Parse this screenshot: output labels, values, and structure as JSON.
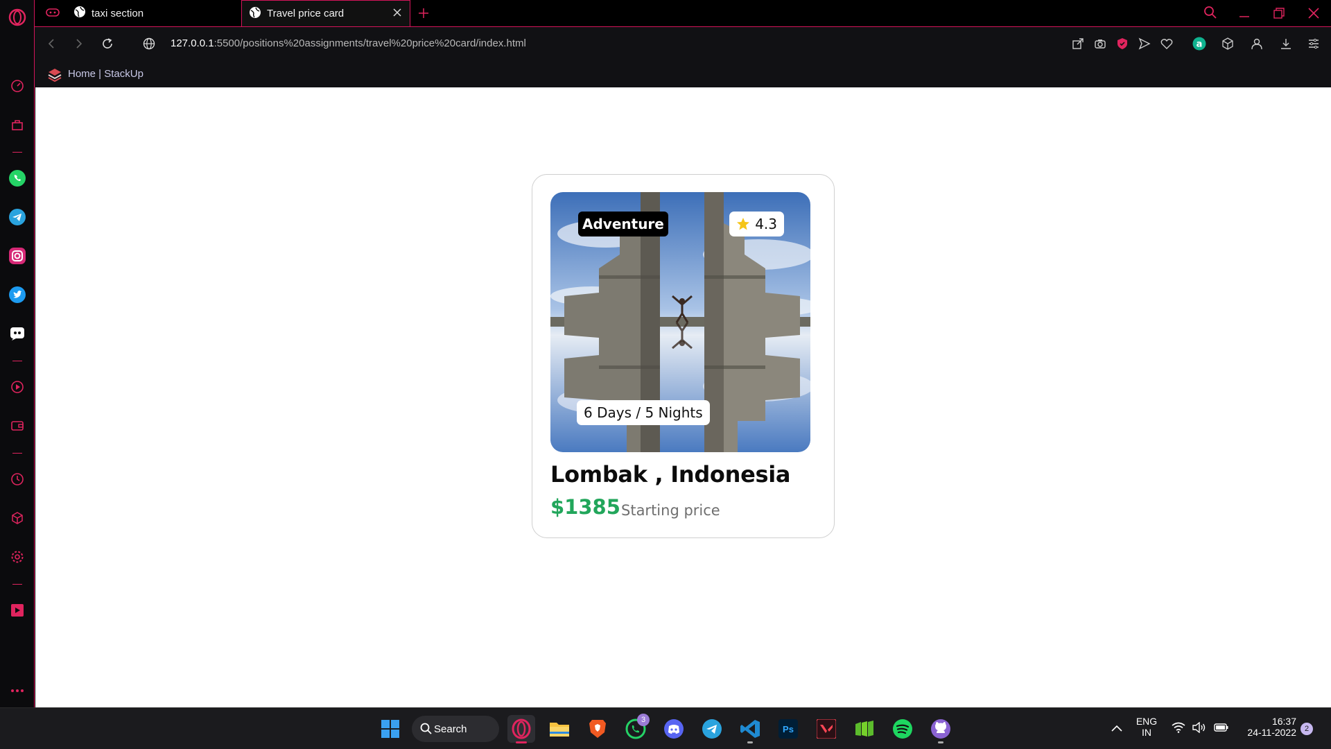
{
  "browser": {
    "tabs": [
      {
        "title": "taxi section",
        "active": false
      },
      {
        "title": "Travel price card",
        "active": true
      }
    ],
    "url_host": "127.0.0.1",
    "url_rest": ":5500/positions%20assignments/travel%20price%20card/index.html",
    "bookmark": "Home | StackUp",
    "accent": "#d4145a"
  },
  "card": {
    "tag": "Adventure",
    "rating": "4.3",
    "duration": "6 Days / 5 Nights",
    "place": "Lombak , Indonesia",
    "price": "$1385",
    "price_note": "Starting price",
    "price_color": "#22a65b"
  },
  "taskbar": {
    "search_label": "Search",
    "whatsapp_badge": "3",
    "lang_top": "ENG",
    "lang_bottom": "IN",
    "time": "16:37",
    "date": "24-11-2022",
    "notif_count": "2"
  }
}
